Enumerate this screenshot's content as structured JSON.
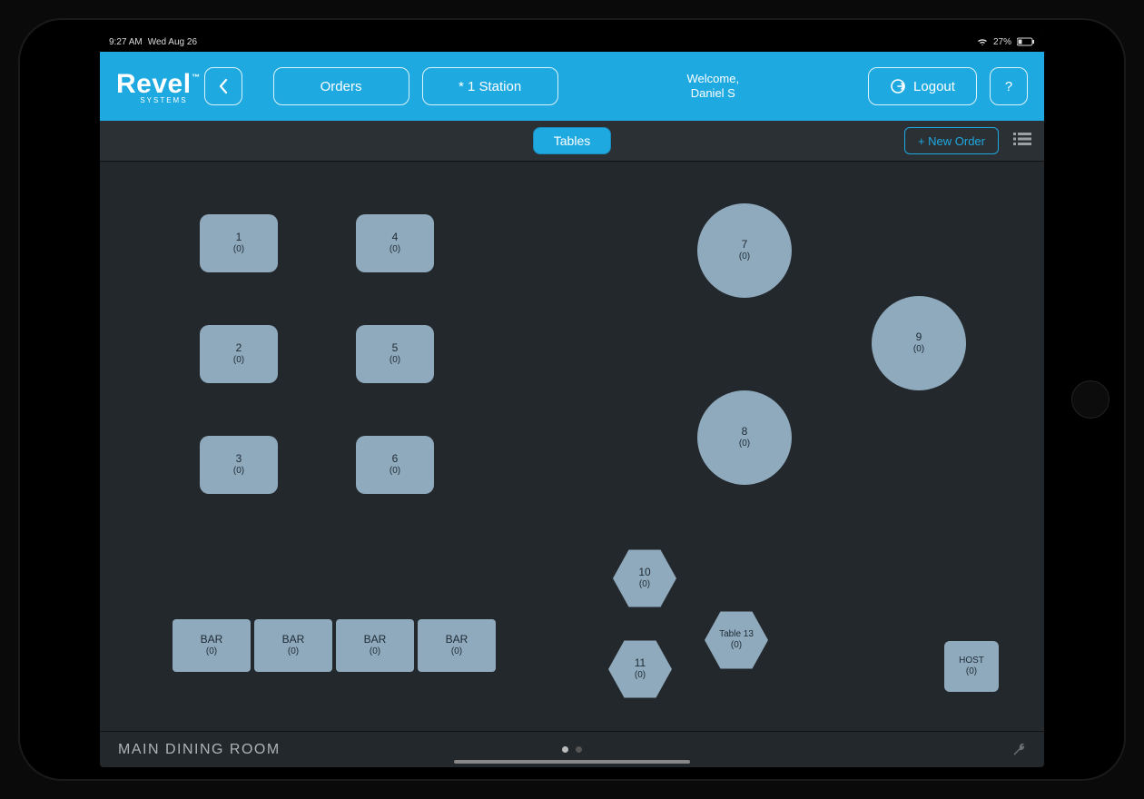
{
  "statusbar": {
    "time": "9:27 AM",
    "date": "Wed Aug 26",
    "battery": "27%"
  },
  "header": {
    "brand": "Revel",
    "brand_sub": "SYSTEMS",
    "orders_label": "Orders",
    "station_label": "* 1 Station",
    "welcome_line1": "Welcome,",
    "welcome_line2": "Daniel S",
    "logout_label": "Logout",
    "help_label": "?"
  },
  "toolbar": {
    "tables_label": "Tables",
    "new_order_label": "+ New Order"
  },
  "footer": {
    "room_label": "MAIN DINING ROOM"
  },
  "tables": {
    "t1": {
      "num": "1",
      "sub": "(0)"
    },
    "t2": {
      "num": "2",
      "sub": "(0)"
    },
    "t3": {
      "num": "3",
      "sub": "(0)"
    },
    "t4": {
      "num": "4",
      "sub": "(0)"
    },
    "t5": {
      "num": "5",
      "sub": "(0)"
    },
    "t6": {
      "num": "6",
      "sub": "(0)"
    },
    "t7": {
      "num": "7",
      "sub": "(0)"
    },
    "t8": {
      "num": "8",
      "sub": "(0)"
    },
    "t9": {
      "num": "9",
      "sub": "(0)"
    },
    "t10": {
      "num": "10",
      "sub": "(0)"
    },
    "t11": {
      "num": "11",
      "sub": "(0)"
    },
    "t13": {
      "num": "Table 13",
      "sub": "(0)"
    },
    "bar1": {
      "num": "BAR",
      "sub": "(0)"
    },
    "bar2": {
      "num": "BAR",
      "sub": "(0)"
    },
    "bar3": {
      "num": "BAR",
      "sub": "(0)"
    },
    "bar4": {
      "num": "BAR",
      "sub": "(0)"
    },
    "host": {
      "num": "HOST",
      "sub": "(0)"
    }
  }
}
